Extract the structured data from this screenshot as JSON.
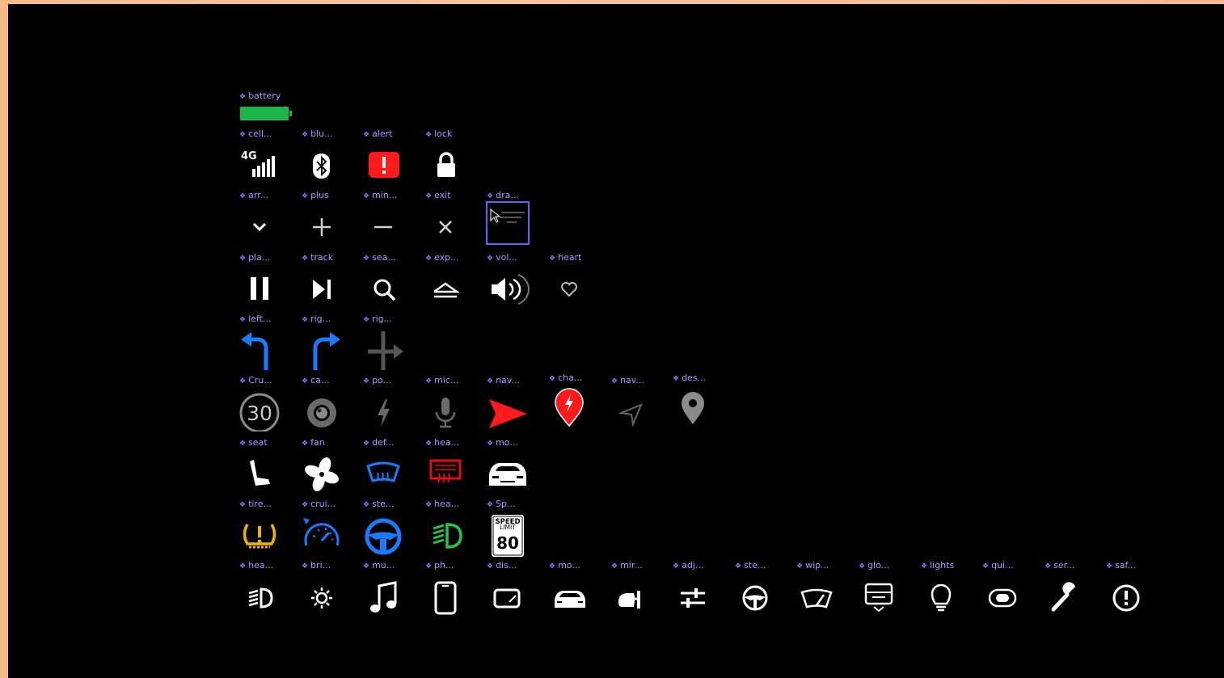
{
  "colors": {
    "label": "#a79bff",
    "battery": "#1db44a",
    "alert_red": "#ff1b1b",
    "nav_blue": "#1a7bff",
    "grey": "#8a8a8a",
    "yellow": "#f0b400",
    "green": "#27c24c",
    "white": "#ffffff"
  },
  "components": [
    {
      "label": "battery",
      "icon": "battery-icon"
    },
    {
      "label": "cell...",
      "icon": "cellular-4g-icon"
    },
    {
      "label": "blu...",
      "icon": "bluetooth-icon"
    },
    {
      "label": "alert",
      "icon": "alert-icon"
    },
    {
      "label": "lock",
      "icon": "lock-icon"
    },
    {
      "label": "arr...",
      "icon": "chevron-down-icon"
    },
    {
      "label": "plus",
      "icon": "plus-icon"
    },
    {
      "label": "min...",
      "icon": "minus-icon"
    },
    {
      "label": "exit",
      "icon": "close-icon"
    },
    {
      "label": "dra...",
      "icon": "drawer-icon"
    },
    {
      "label": "pla...",
      "icon": "pause-icon"
    },
    {
      "label": "track",
      "icon": "next-track-icon"
    },
    {
      "label": "sea...",
      "icon": "search-icon"
    },
    {
      "label": "exp...",
      "icon": "expand-icon"
    },
    {
      "label": "vol...",
      "icon": "volume-icon"
    },
    {
      "label": "heart",
      "icon": "heart-icon"
    },
    {
      "label": "left...",
      "icon": "turn-left-icon"
    },
    {
      "label": "rig...",
      "icon": "turn-right-icon"
    },
    {
      "label": "rig...",
      "icon": "right-crossroad-icon"
    },
    {
      "label": "Cru...",
      "icon": "cruise-speed-icon"
    },
    {
      "label": "ca...",
      "icon": "camera-icon"
    },
    {
      "label": "po...",
      "icon": "power-bolt-icon"
    },
    {
      "label": "mic...",
      "icon": "microphone-icon"
    },
    {
      "label": "nav...",
      "icon": "nav-arrow-red-icon"
    },
    {
      "label": "cha...",
      "icon": "charger-pin-icon"
    },
    {
      "label": "nav...",
      "icon": "nav-arrow-outline-icon"
    },
    {
      "label": "des...",
      "icon": "destination-pin-icon"
    },
    {
      "label": "seat",
      "icon": "seat-icon"
    },
    {
      "label": "fan",
      "icon": "fan-icon"
    },
    {
      "label": "def...",
      "icon": "defrost-front-icon"
    },
    {
      "label": "hea...",
      "icon": "heated-rear-window-icon"
    },
    {
      "label": "mo...",
      "icon": "model-car-front-icon"
    },
    {
      "label": "tire...",
      "icon": "tire-pressure-icon"
    },
    {
      "label": "crui...",
      "icon": "cruise-gauge-icon"
    },
    {
      "label": "ste...",
      "icon": "steering-wheel-blue-icon"
    },
    {
      "label": "hea...",
      "icon": "headlight-green-icon"
    },
    {
      "label": "Sp...",
      "icon": "speed-limit-sign-icon",
      "sign_top": "SPEED",
      "sign_mid": "LIMIT",
      "sign_value": "80"
    },
    {
      "label": "hea...",
      "icon": "headlight-icon"
    },
    {
      "label": "bri...",
      "icon": "brightness-icon"
    },
    {
      "label": "mu...",
      "icon": "music-note-icon"
    },
    {
      "label": "ph...",
      "icon": "phone-icon"
    },
    {
      "label": "dis...",
      "icon": "display-icon"
    },
    {
      "label": "mo...",
      "icon": "car-icon"
    },
    {
      "label": "mir...",
      "icon": "mirror-icon"
    },
    {
      "label": "adj...",
      "icon": "sliders-icon"
    },
    {
      "label": "ste...",
      "icon": "steering-wheel-icon"
    },
    {
      "label": "wip...",
      "icon": "wiper-icon"
    },
    {
      "label": "glo...",
      "icon": "glovebox-icon"
    },
    {
      "label": "lights",
      "icon": "lightbulb-icon"
    },
    {
      "label": "qui...",
      "icon": "quick-toggle-icon"
    },
    {
      "label": "ser...",
      "icon": "wrench-icon"
    },
    {
      "label": "saf...",
      "icon": "safety-alert-icon"
    }
  ],
  "cruise_speed_value": "30"
}
